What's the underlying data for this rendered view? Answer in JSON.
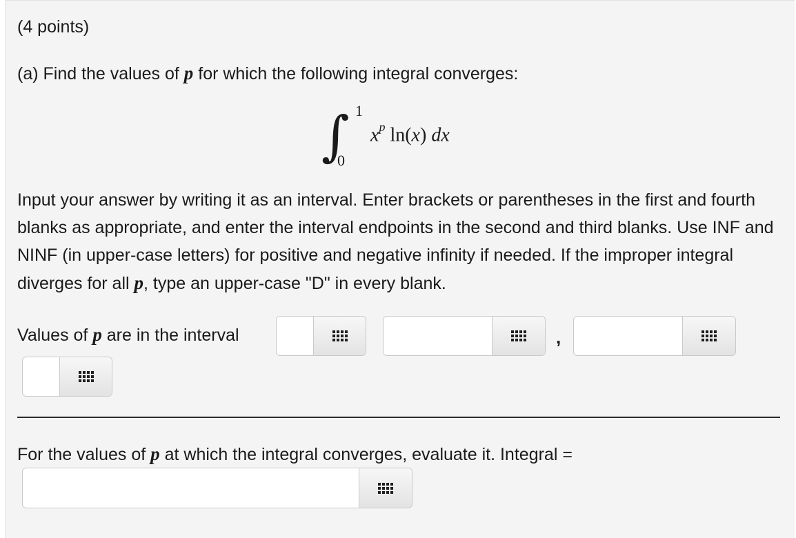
{
  "header": {
    "points": "(4 points)"
  },
  "part_a": {
    "prefix": "(a) Find the values of ",
    "var": "p",
    "suffix": " for which the following integral converges:"
  },
  "integral": {
    "sign": "∫",
    "upper": "1",
    "lower": "0",
    "base": "x",
    "exponent": "p",
    "body": " ln(",
    "arg": "x",
    "close": ") ",
    "d": "dx"
  },
  "instructions": {
    "text1": "Input your answer by writing it as an interval. Enter brackets or parentheses in the first and fourth blanks as appropriate, and enter the interval endpoints in the second and third blanks. Use INF and NINF (in upper-case letters) for positive and negative infinity if needed. If the improper integral diverges for all ",
    "var": "p",
    "text2": ", type an upper-case \"D\" in every blank."
  },
  "interval_row": {
    "label_prefix": "Values of ",
    "var": "p",
    "label_suffix": " are in the interval",
    "separator": ",",
    "blank1_value": "",
    "blank2_value": "",
    "blank3_value": "",
    "blank4_value": ""
  },
  "part_b": {
    "prefix": "For the values of ",
    "var": "p",
    "suffix": " at which the integral converges, evaluate it. Integral =",
    "answer_value": ""
  },
  "icons": {
    "palette_button": "grid-icon"
  }
}
